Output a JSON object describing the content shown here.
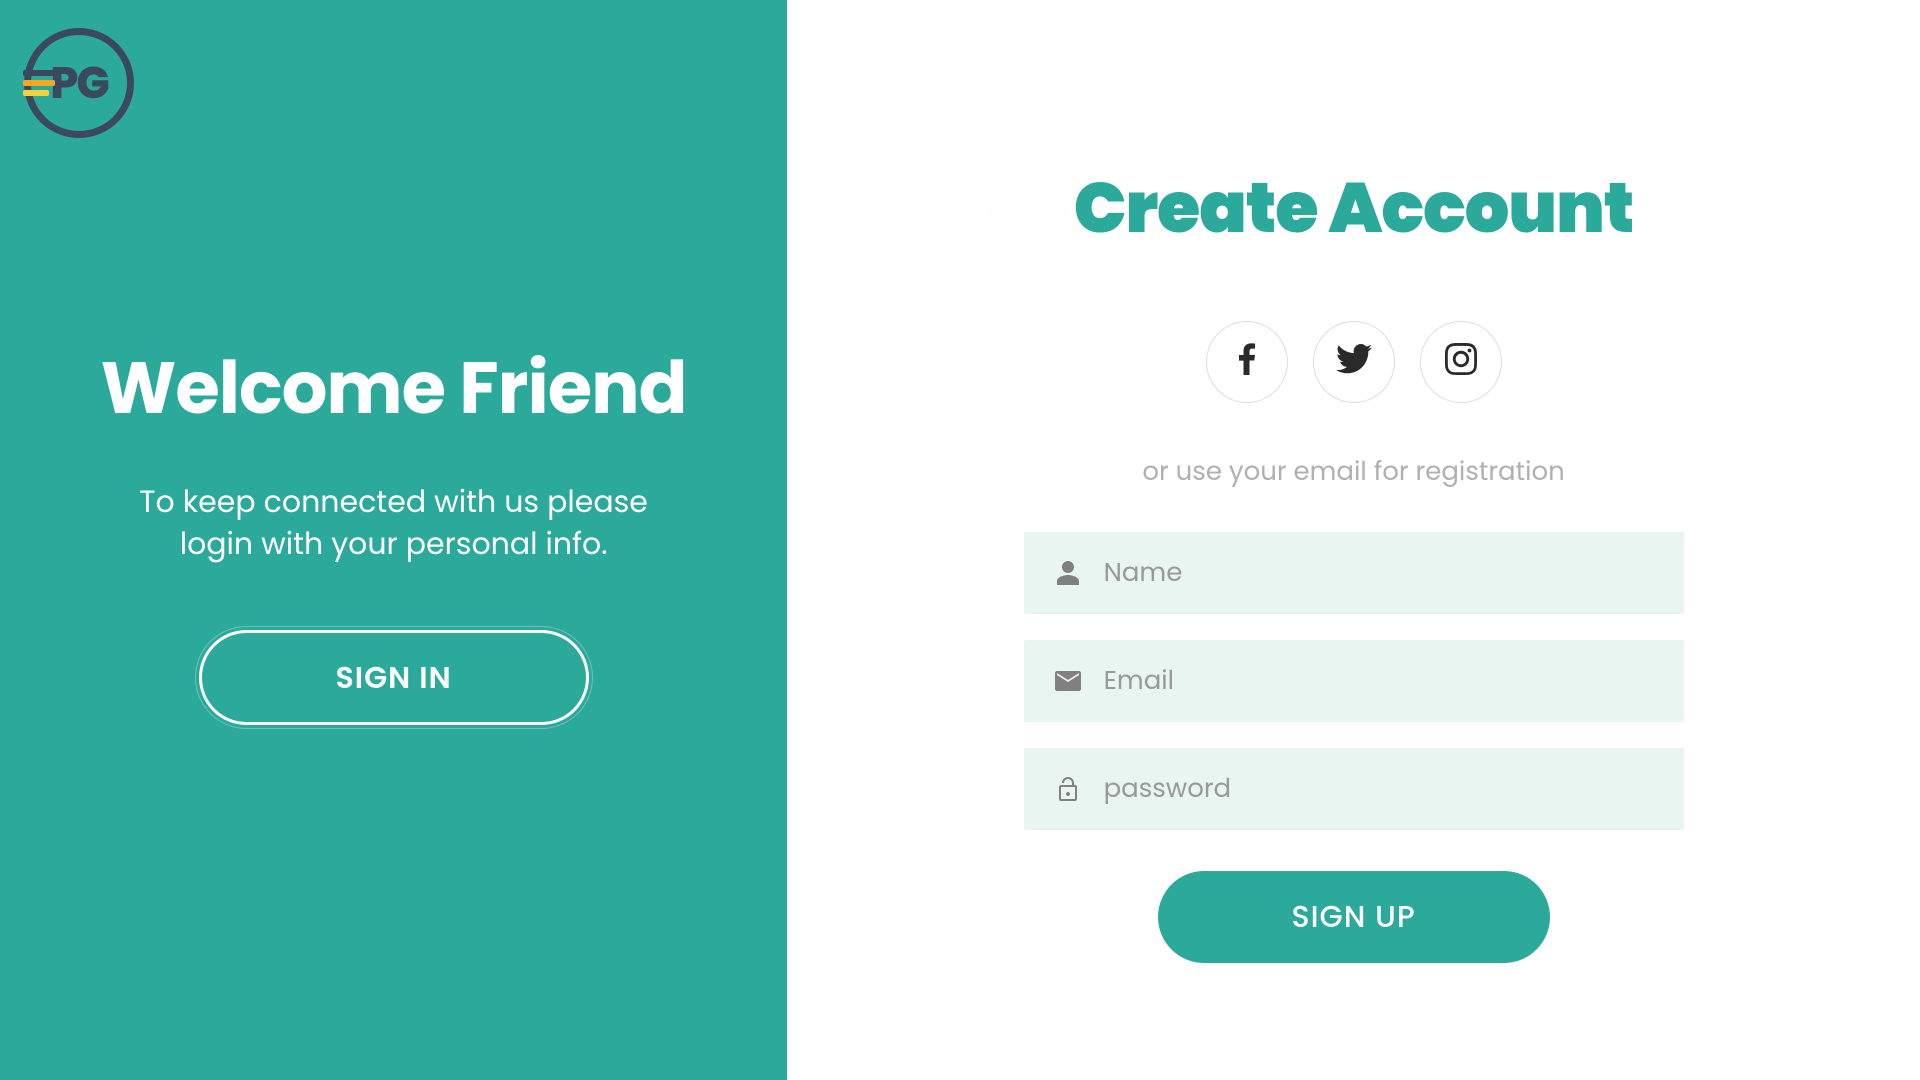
{
  "colors": {
    "primary": "#2ba99a",
    "dark": "#3a4a5c",
    "input_bg": "#e8f5f1"
  },
  "logo": {
    "text": "PG"
  },
  "left": {
    "heading": "Welcome Friend",
    "subtext": "To keep connected with us please login with your personal info.",
    "button": "SIGN IN"
  },
  "right": {
    "heading": "Create Account",
    "social": [
      "facebook",
      "twitter",
      "instagram"
    ],
    "divider": "or use your email for registration",
    "inputs": {
      "name": {
        "placeholder": "Name",
        "value": ""
      },
      "email": {
        "placeholder": "Email",
        "value": ""
      },
      "password": {
        "placeholder": "password",
        "value": ""
      }
    },
    "button": "SIGN UP"
  }
}
